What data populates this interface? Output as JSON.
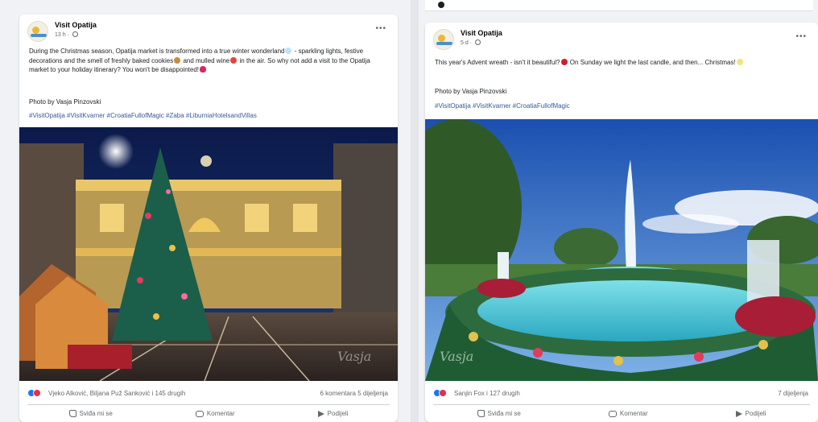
{
  "posts": [
    {
      "page_name": "Visit Opatija",
      "time": "13 h",
      "text_parts": [
        "During the Christmas season, Opatija market is transformed into a true winter wonderland",
        " - sparkling lights, festive decorations and the smell of freshly baked cookies",
        " and mulled wine",
        " in the air. So why not add a visit to the Opatija market to your holiday itinerary? You won't be disappointed!"
      ],
      "credit": "Photo by Vasja Pinzovski",
      "hashtags": "#VisitOpatija #VisitKvarner #CroatiaFullofMagic #Zaba #LiburniaHotelsandVillas",
      "reactors": "Vjeko Alković, Biljana Puž Sanković i 145 drugih",
      "counts": "6 komentara  5 dijeljenja",
      "watermark": "Vasja",
      "actions": {
        "like": "Sviđa mi se",
        "comment": "Komentar",
        "share": "Podijeli"
      }
    },
    {
      "page_name": "Visit Opatija",
      "time": "5 d",
      "text_parts": [
        "This year's Advent wreath - isn't it beautiful?",
        " On Sunday we light the last candle, and then... Christmas!"
      ],
      "credit": "Photo by Vasja Pinzovski",
      "hashtags": "#VisitOpatija #VisitKvarner #CroatiaFullofMagic",
      "reactors": "Sanjin Fox i 127 drugih",
      "counts": "7 dijeljenja",
      "watermark": "Vasja",
      "actions": {
        "like": "Sviđa mi se",
        "comment": "Komentar",
        "share": "Podijeli"
      }
    }
  ],
  "icons": [
    "globe-icon",
    "more-icon",
    "like-icon",
    "love-icon",
    "thumb-icon",
    "comment-icon",
    "share-icon"
  ],
  "colors": {
    "link": "#385898",
    "like": "#1877f2",
    "love": "#f02849",
    "secondary_text": "#65676b"
  }
}
